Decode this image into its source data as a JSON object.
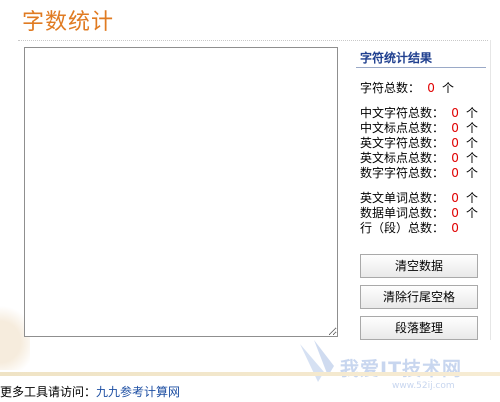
{
  "page": {
    "title": "字数统计"
  },
  "panel": {
    "title": "字符统计结果"
  },
  "stats": {
    "total": {
      "label": "字符总数：",
      "value": "0",
      "unit": "个"
    },
    "cn_chars": {
      "label": "中文字符总数：",
      "value": "0",
      "unit": "个"
    },
    "cn_punct": {
      "label": "中文标点总数：",
      "value": "0",
      "unit": "个"
    },
    "en_chars": {
      "label": "英文字符总数：",
      "value": "0",
      "unit": "个"
    },
    "en_punct": {
      "label": "英文标点总数：",
      "value": "0",
      "unit": "个"
    },
    "digit_chars": {
      "label": "数字字符总数：",
      "value": "0",
      "unit": "个"
    },
    "en_words": {
      "label": "英文单词总数：",
      "value": "0",
      "unit": "个"
    },
    "num_words": {
      "label": "数据单词总数：",
      "value": "0",
      "unit": "个"
    },
    "lines": {
      "label": "行（段）总数：",
      "value": "0"
    }
  },
  "buttons": {
    "clear": "清空数据",
    "trim_trailing": "清除行尾空格",
    "format_paragraphs": "段落整理"
  },
  "footer": {
    "prefix": "更多工具请访问：",
    "link_text": "九九参考计算网"
  },
  "watermark": {
    "text": "我爱IT技术网",
    "url": "www.52ij.com"
  },
  "colors": {
    "title": "#e07b22",
    "value": "#e00000",
    "panel_title": "#1f3f8f",
    "link": "#1e4fa3"
  }
}
